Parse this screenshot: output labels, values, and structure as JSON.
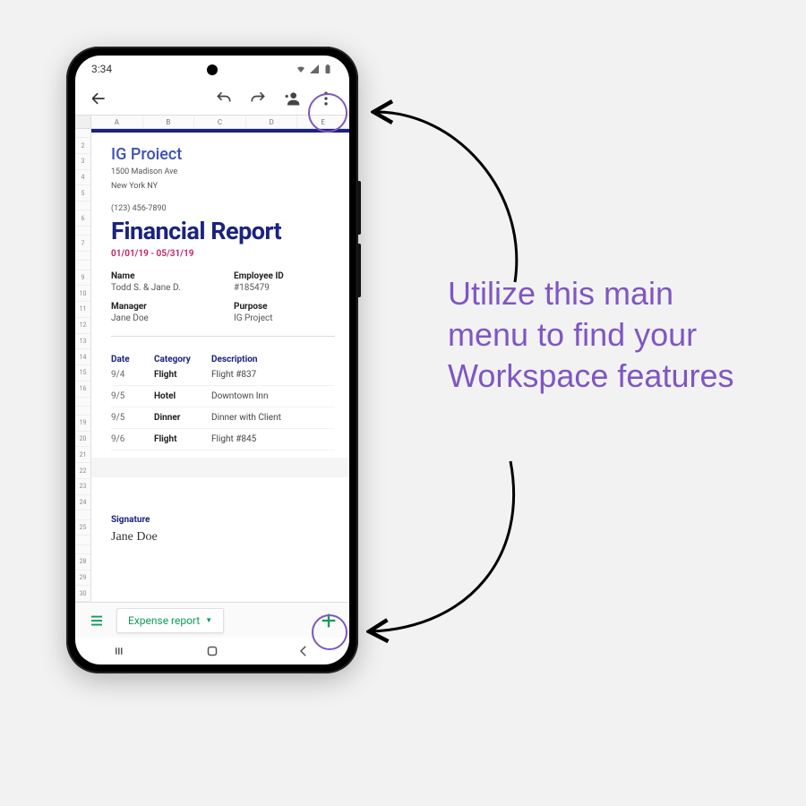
{
  "status": {
    "time": "3:34"
  },
  "columns": [
    "A",
    "B",
    "C",
    "D",
    "E"
  ],
  "rows_top": [
    "",
    "2",
    "3",
    "4",
    "5",
    "",
    "6",
    "",
    "7",
    "",
    "",
    "9",
    "10",
    "11",
    "12",
    "13",
    "14",
    "15",
    "16",
    "",
    "",
    "19",
    "20",
    "21",
    "22",
    "23",
    "24",
    "",
    "25",
    "",
    "",
    "28",
    "29",
    "30"
  ],
  "doc": {
    "company": "IG Proiect",
    "addr1": "1500 Madison Ave",
    "addr2": "New York NY",
    "phone": "(123) 456-7890",
    "title": "Financial Report",
    "date_range": "01/01/19 - 05/31/19",
    "name_label": "Name",
    "name_val": "Todd S. & Jane D.",
    "empid_label": "Employee ID",
    "empid_val": "#185479",
    "mgr_label": "Manager",
    "mgr_val": "Jane Doe",
    "purpose_label": "Purpose",
    "purpose_val": "IG Project",
    "h_date": "Date",
    "h_cat": "Category",
    "h_desc": "Description",
    "rows": [
      {
        "d": "9/4",
        "c": "Flight",
        "desc": "Flight #837"
      },
      {
        "d": "9/5",
        "c": "Hotel",
        "desc": "Downtown Inn"
      },
      {
        "d": "9/5",
        "c": "Dinner",
        "desc": "Dinner with Client"
      },
      {
        "d": "9/6",
        "c": "Flight",
        "desc": "Flight #845"
      }
    ],
    "sig_label": "Signature",
    "sig_name": "Jane Doe"
  },
  "tab": {
    "label": "Expense report"
  },
  "callout": "Utilize this main menu to find your Workspace features"
}
